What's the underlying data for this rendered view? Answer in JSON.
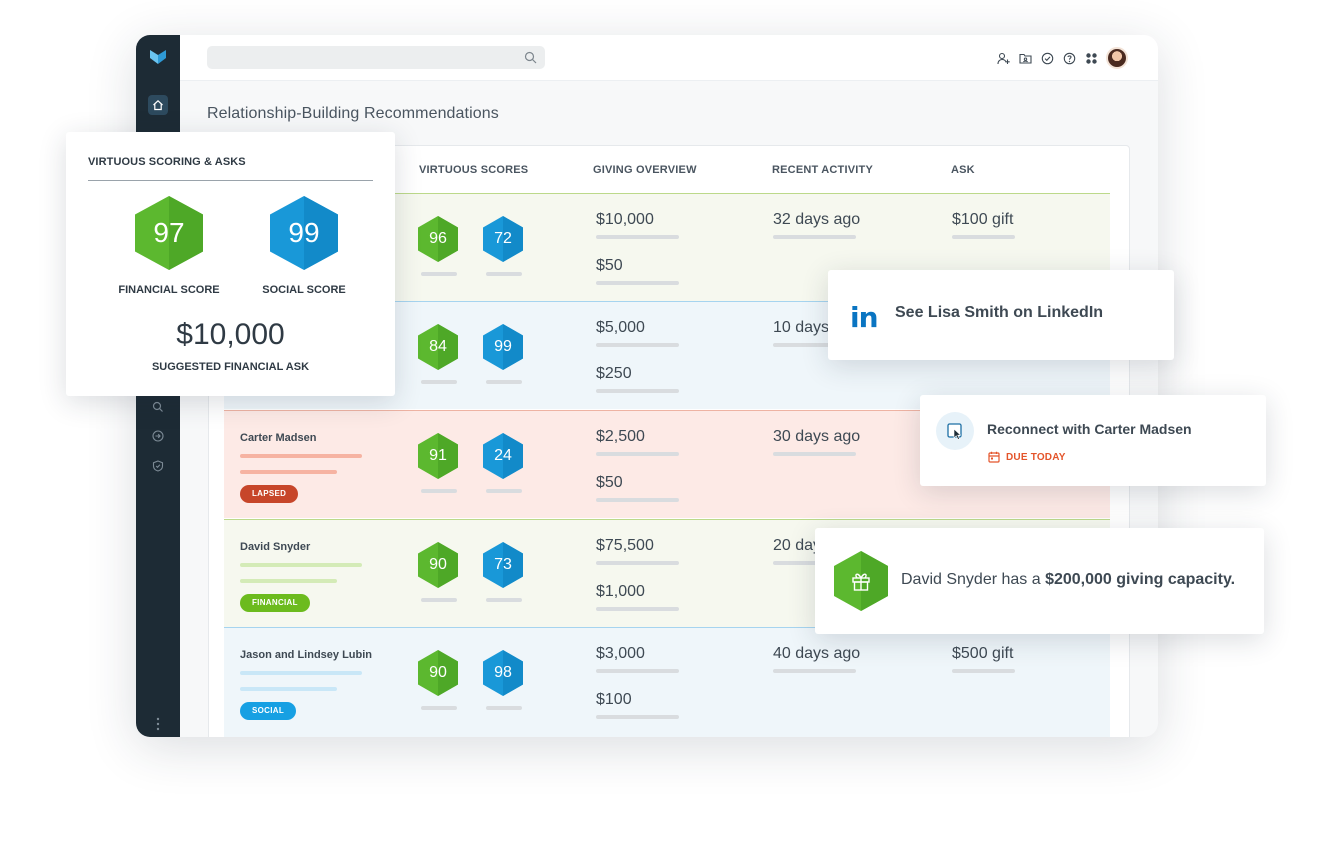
{
  "page": {
    "title": "Relationship-Building Recommendations"
  },
  "icons": {
    "logo": "virtuous-logo",
    "sidebar": [
      "home-icon",
      "search-icon",
      "login-icon",
      "shield-icon",
      "more-vertical-icon"
    ],
    "topbar": [
      "add-user-icon",
      "folder-icon",
      "check-circle-icon",
      "help-icon",
      "apps-icon"
    ]
  },
  "colors": {
    "sidebar": "#1d2b35",
    "financial_green": "#5cb82f",
    "social_blue": "#1998d8",
    "lapsed_red": "#c7462a",
    "linkedin_blue": "#0a75c2",
    "due_orange": "#e4542a"
  },
  "table": {
    "columns": {
      "scores": "VIRTUOUS SCORES",
      "giving": "GIVING OVERVIEW",
      "recent": "RECENT ACTIVITY",
      "ask": "ASK"
    },
    "rows": [
      {
        "name": "",
        "tag": "",
        "financial": "96",
        "social": "72",
        "giving_total": "$10,000",
        "giving_last": "$50",
        "recent": "32 days ago",
        "ask": "$100 gift"
      },
      {
        "name": "",
        "tag": "",
        "financial": "84",
        "social": "99",
        "giving_total": "$5,000",
        "giving_last": "$250",
        "recent": "10 days",
        "ask": ""
      },
      {
        "name": "Carter Madsen",
        "tag": "LAPSED",
        "financial": "91",
        "social": "24",
        "giving_total": "$2,500",
        "giving_last": "$50",
        "recent": "30 days ago",
        "ask": ""
      },
      {
        "name": "David Snyder",
        "tag": "FINANCIAL",
        "financial": "90",
        "social": "73",
        "giving_total": "$75,500",
        "giving_last": "$1,000",
        "recent": "20 day",
        "ask": ""
      },
      {
        "name": "Jason and Lindsey Lubin",
        "tag": "SOCIAL",
        "financial": "90",
        "social": "98",
        "giving_total": "$3,000",
        "giving_last": "$100",
        "recent": "40 days ago",
        "ask": "$500 gift"
      }
    ]
  },
  "score_card": {
    "title": "VIRTUOUS SCORING & ASKS",
    "financial_score": "97",
    "financial_label": "FINANCIAL SCORE",
    "social_score": "99",
    "social_label": "SOCIAL SCORE",
    "ask_amount": "$10,000",
    "ask_label": "SUGGESTED FINANCIAL ASK"
  },
  "linkedin_card": {
    "logo": "in",
    "text": "See Lisa Smith on LinkedIn"
  },
  "reconnect_card": {
    "text": "Reconnect with Carter Madsen",
    "due": "DUE TODAY"
  },
  "gift_card": {
    "prefix": "David Snyder has a ",
    "highlight": "$200,000 giving capacity."
  }
}
